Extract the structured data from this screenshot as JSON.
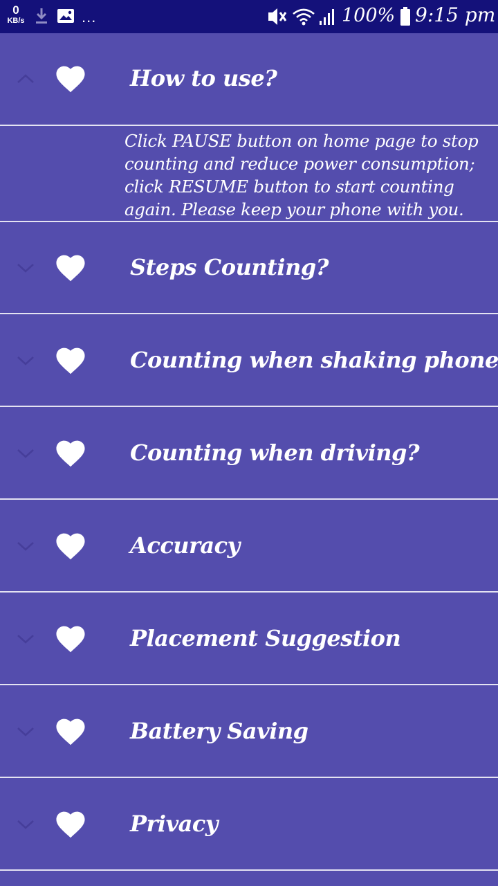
{
  "status_bar": {
    "net_speed_value": "0",
    "net_speed_unit": "KB/s",
    "more_indicator": "...",
    "battery_percent": "100%",
    "time": "9:15 pm"
  },
  "faq": {
    "items": [
      {
        "label": "How to use?",
        "expanded": true,
        "answer": "Click PAUSE button on home page to stop\ncounting and reduce power consumption;\nclick RESUME button to start counting\nagain. Please keep your phone with you."
      },
      {
        "label": "Steps Counting?",
        "expanded": false
      },
      {
        "label": "Counting when shaking phone?",
        "expanded": false
      },
      {
        "label": "Counting when driving?",
        "expanded": false
      },
      {
        "label": "Accuracy",
        "expanded": false
      },
      {
        "label": "Placement Suggestion",
        "expanded": false
      },
      {
        "label": "Battery Saving",
        "expanded": false
      },
      {
        "label": "Privacy",
        "expanded": false
      }
    ]
  },
  "colors": {
    "background": "#544dad",
    "status_bar": "#14117a",
    "text": "#ffffff",
    "divider": "#e4e3f2",
    "chevron": "#463e9a"
  },
  "icons": {
    "status_left": [
      "download-icon",
      "image-icon"
    ],
    "status_right": [
      "vibrate-mute-icon",
      "wifi-icon",
      "signal-icon",
      "battery-icon"
    ],
    "row_icon": "heart-icon",
    "expand_icon": "chevron-down-icon",
    "collapse_icon": "chevron-up-icon"
  }
}
